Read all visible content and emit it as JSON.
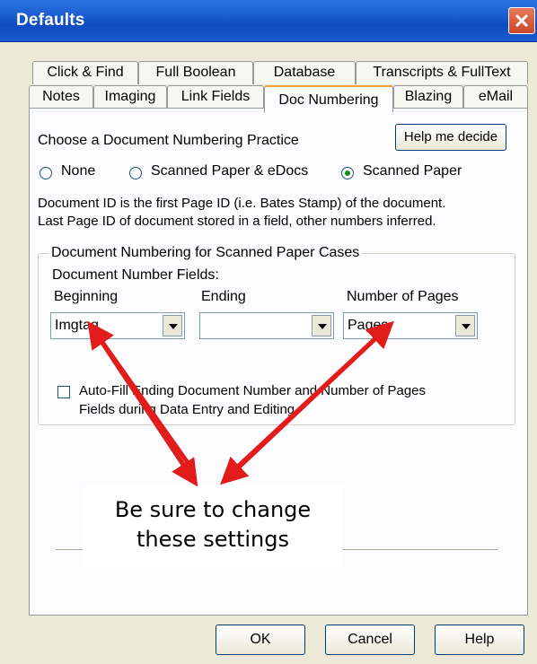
{
  "window": {
    "title": "Defaults"
  },
  "tabs": {
    "row1": [
      "Click & Find",
      "Full Boolean",
      "Database",
      "Transcripts & FullText"
    ],
    "row2": [
      "Notes",
      "Imaging",
      "Link Fields",
      "Doc Numbering",
      "Blazing",
      "eMail"
    ],
    "active": "Doc Numbering"
  },
  "practice": {
    "heading": "Choose a Document Numbering Practice",
    "help_button": "Help me decide",
    "options": [
      "None",
      "Scanned Paper & eDocs",
      "Scanned Paper"
    ],
    "selected": "Scanned Paper",
    "description_line1": "Document ID is the first Page ID (i.e. Bates Stamp) of the document.",
    "description_line2": "Last Page ID of document stored in a field, other numbers inferred."
  },
  "group": {
    "title": "Document Numbering for Scanned Paper Cases",
    "fields_label": "Document Number Fields:",
    "beginning_label": "Beginning",
    "beginning_value": "Imgtag",
    "ending_label": "Ending",
    "ending_value": "",
    "pages_label": "Number of Pages",
    "pages_value": "Pages",
    "autofill_line1": "Auto-Fill Ending Document Number and Number of Pages",
    "autofill_line2": "Fields during Data Entry and Editing"
  },
  "callout": {
    "line1": "Be sure to change",
    "line2": "these settings",
    "arrow_color": "#e21b1b"
  },
  "buttons": {
    "ok": "OK",
    "cancel": "Cancel",
    "help": "Help"
  }
}
